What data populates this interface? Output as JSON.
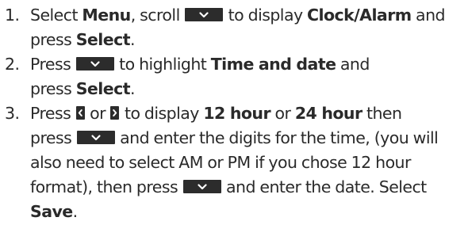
{
  "steps": [
    {
      "number": "1.",
      "l1a": "Select ",
      "l1b": "Menu",
      "l1c": ", scroll ",
      "l1d": " to display ",
      "l1e": "Clock/Alarm",
      "l1f": " and",
      "l2a": "press ",
      "l2b": "Select",
      "l2c": "."
    },
    {
      "number": "2.",
      "l1a": "Press ",
      "l1b": " to highlight ",
      "l1c": "Time and date",
      "l1d": " and",
      "l2a": "press ",
      "l2b": "Select",
      "l2c": "."
    },
    {
      "number": "3.",
      "l1a": "Press ",
      "l1b": " or ",
      "l1c": " to display ",
      "l1d": "12 hour",
      "l1e": " or ",
      "l1f": "24 hour",
      "l1g": " then",
      "l2a": "press ",
      "l2b": " and enter the digits for the time, (you will",
      "l3": "also need to select AM or PM if you chose 12 hour",
      "l4a": "format), then press ",
      "l4b": " and enter the date. Select",
      "l5a": "Save",
      "l5b": "."
    }
  ],
  "icons": {
    "down": "chevron-down-key",
    "left": "chevron-left-key",
    "right": "chevron-right-key"
  },
  "colors": {
    "text": "#2a2a2a",
    "key": "#2c2c2c"
  }
}
